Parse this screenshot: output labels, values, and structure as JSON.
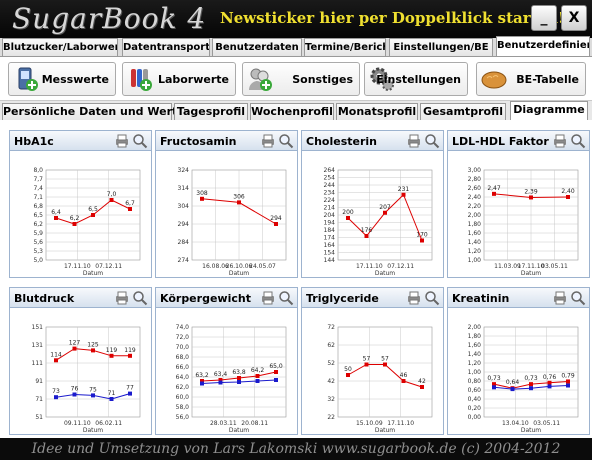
{
  "app": {
    "title": "SugarBook 4",
    "ticker": "Newsticker hier per Doppelklick starten!",
    "minimize": "_",
    "close": "X"
  },
  "main_tabs": [
    {
      "label": "Blutzucker/Laborwerte"
    },
    {
      "label": "Datentransport"
    },
    {
      "label": "Benutzerdaten"
    },
    {
      "label": "Termine/Berichte"
    },
    {
      "label": "Einstellungen/BE"
    },
    {
      "label": "Benutzerdefiniert",
      "active": true
    }
  ],
  "toolbar": [
    {
      "label": "Messwerte",
      "icon": "phone-meter-icon"
    },
    {
      "label": "Laborwerte",
      "icon": "test-tubes-icon"
    },
    {
      "label": "Sonstiges",
      "icon": "users-icon"
    },
    {
      "label": "Einstellungen",
      "icon": "gears-icon"
    },
    {
      "label": "BE-Tabelle",
      "icon": "bread-icon"
    }
  ],
  "sub_tabs": [
    {
      "label": "Persönliche Daten und Werte"
    },
    {
      "label": "Tagesprofil"
    },
    {
      "label": "Wochenprofil"
    },
    {
      "label": "Monatsprofil"
    },
    {
      "label": "Gesamtprofil"
    },
    {
      "label": "Diagramme",
      "active": true
    }
  ],
  "colors": {
    "series_red": "#dd0000",
    "series_blue": "#1a1acc",
    "panel_border": "#9db3cf"
  },
  "chart_data": [
    {
      "title": "HbA1c",
      "type": "line",
      "ylim": [
        5.0,
        8.0
      ],
      "ticks": [
        "8,0",
        "7,7",
        "7,4",
        "7,1",
        "6,8",
        "6,5",
        "6,2",
        "5,9",
        "5,6",
        "5,3",
        "5,0"
      ],
      "xticks": [
        "17.11.10",
        "07.12.11"
      ],
      "xlabel": "Datum",
      "series": [
        {
          "color": "#dd0000",
          "values": [
            6.4,
            6.2,
            6.5,
            7.0,
            6.7
          ],
          "labels": [
            "6,4",
            "6,2",
            "6,5",
            "7,0",
            "6,7"
          ]
        }
      ]
    },
    {
      "title": "Fructosamin",
      "type": "line",
      "ylim": [
        274,
        324
      ],
      "ticks": [
        "324",
        "314",
        "304",
        "294",
        "284",
        "274"
      ],
      "xticks": [
        "16.08.06",
        "26.10.06",
        "24.05.07"
      ],
      "xlabel": "Datum",
      "series": [
        {
          "color": "#dd0000",
          "values": [
            308,
            306,
            294
          ],
          "labels": [
            "308",
            "306",
            "294"
          ]
        }
      ]
    },
    {
      "title": "Cholesterin",
      "type": "line",
      "ylim": [
        144,
        264
      ],
      "ticks": [
        "264",
        "254",
        "244",
        "234",
        "224",
        "214",
        "204",
        "194",
        "184",
        "174",
        "164",
        "154",
        "144"
      ],
      "xticks": [
        "17.11.10",
        "07.12.11"
      ],
      "xlabel": "Datum",
      "series": [
        {
          "color": "#dd0000",
          "values": [
            200,
            176,
            207,
            231,
            170
          ],
          "labels": [
            "200",
            "176",
            "207",
            "231",
            "170"
          ]
        }
      ]
    },
    {
      "title": "LDL-HDL Faktor",
      "type": "line",
      "ylim": [
        1.0,
        3.0
      ],
      "ticks": [
        "3,00",
        "2,80",
        "2,60",
        "2,40",
        "2,20",
        "2,00",
        "1,80",
        "1,60",
        "1,40",
        "1,20",
        "1,00"
      ],
      "xticks": [
        "11.03.09",
        "17.11.10",
        "03.05.11"
      ],
      "xlabel": "Datum",
      "series": [
        {
          "color": "#dd0000",
          "values": [
            2.47,
            2.39,
            2.4
          ],
          "labels": [
            "2,47",
            "2,39",
            "2,40"
          ]
        }
      ]
    },
    {
      "title": "Blutdruck",
      "type": "line",
      "ylim": [
        51,
        151
      ],
      "ticks": [
        "151",
        "131",
        "111",
        "91",
        "71",
        "51"
      ],
      "xticks": [
        "09.11.10",
        "06.02.11"
      ],
      "xlabel": "Datum",
      "series": [
        {
          "color": "#dd0000",
          "values": [
            114,
            127,
            125,
            119,
            119
          ],
          "labels": [
            "114",
            "127",
            "125",
            "119",
            "119"
          ]
        },
        {
          "color": "#1a1acc",
          "values": [
            73,
            76,
            75,
            71,
            77
          ],
          "labels": [
            "73",
            "76",
            "75",
            "71",
            "77"
          ]
        }
      ]
    },
    {
      "title": "Körpergewicht",
      "type": "line",
      "ylim": [
        56.0,
        74.0
      ],
      "ticks": [
        "74,0",
        "72,0",
        "70,0",
        "68,0",
        "66,0",
        "64,0",
        "62,0",
        "60,0",
        "58,0",
        "56,0"
      ],
      "xticks": [
        "28.03.11",
        "20.08.11"
      ],
      "xlabel": "Datum",
      "series": [
        {
          "color": "#dd0000",
          "values": [
            63.2,
            63.4,
            63.8,
            64.2,
            65.0
          ],
          "labels": [
            "63,2",
            "63,4",
            "63,8",
            "64,2",
            "65,0"
          ]
        },
        {
          "color": "#1a1acc",
          "values": [
            62.7,
            62.9,
            63.0,
            63.2,
            63.4
          ],
          "labels": []
        }
      ]
    },
    {
      "title": "Triglyceride",
      "type": "line",
      "ylim": [
        22,
        82
      ],
      "ticks": [
        "72",
        "62",
        "52",
        "42",
        "32",
        "22"
      ],
      "xticks": [
        "15.10.09",
        "17.11.10"
      ],
      "xlabel": "Datum",
      "series": [
        {
          "color": "#dd0000",
          "values": [
            50,
            57,
            57,
            46,
            42
          ],
          "labels": [
            "50",
            "57",
            "57",
            "46",
            "42"
          ]
        }
      ]
    },
    {
      "title": "Kreatinin",
      "type": "line",
      "ylim": [
        0.0,
        2.0
      ],
      "ticks": [
        "2,00",
        "1,80",
        "1,60",
        "1,40",
        "1,20",
        "1,00",
        "0,80",
        "0,60",
        "0,40",
        "0,20",
        "0,00"
      ],
      "xticks": [
        "13.04.10",
        "03.05.11"
      ],
      "xlabel": "Datum",
      "series": [
        {
          "color": "#dd0000",
          "values": [
            0.73,
            0.64,
            0.73,
            0.76,
            0.79
          ],
          "labels": [
            "0,73",
            "0,64",
            "0,73",
            "0,76",
            "0,79"
          ]
        },
        {
          "color": "#1a1acc",
          "values": [
            0.66,
            0.62,
            0.64,
            0.68,
            0.7
          ],
          "labels": []
        }
      ]
    }
  ],
  "footer": "Idee und Umsetzung von Lars Lakomski www.sugarbook.de (c) 2004-2012"
}
